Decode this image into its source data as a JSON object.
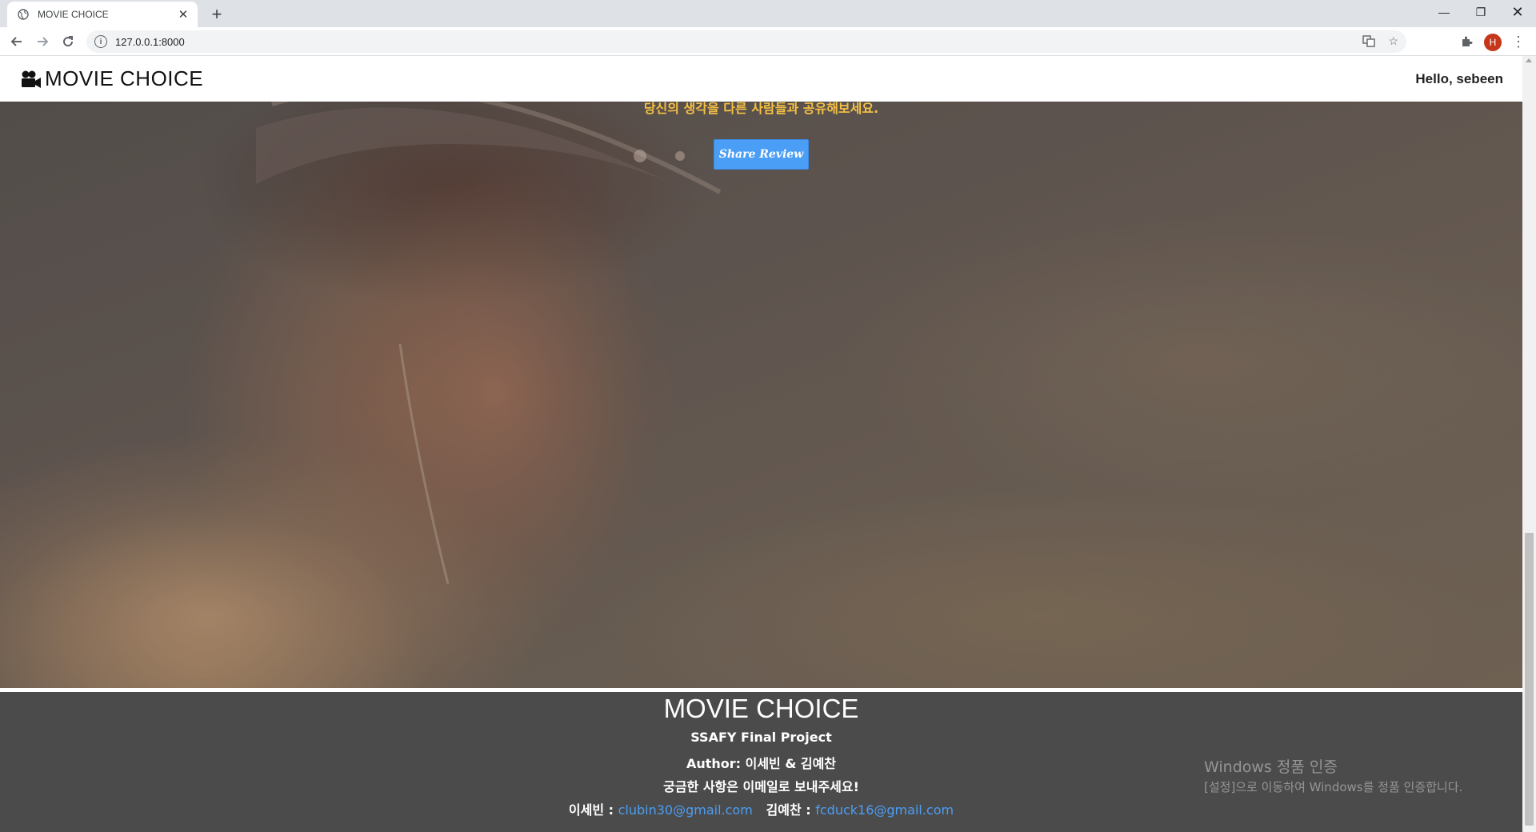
{
  "browser": {
    "tab_title": "MOVIE CHOICE",
    "url": "127.0.0.1:8000",
    "profile_initial": "H"
  },
  "navbar": {
    "brand": "MOVIE CHOICE",
    "greeting": "Hello, sebeen"
  },
  "hero": {
    "subtitle": "당신의 생각을 다른 사람들과 공유해보세요.",
    "share_button": "Share Review"
  },
  "footer": {
    "title": "MOVIE CHOICE",
    "project": "SSAFY Final Project",
    "authors": "Author: 이세빈 & 김예찬",
    "contact_note": "궁금한 사항은 이메일로 보내주세요!",
    "author1_label": "이세빈 :",
    "author1_email": "clubin30@gmail.com",
    "author2_label": "김예찬 :",
    "author2_email": "fcduck16@gmail.com"
  },
  "watermark": {
    "line1": "Windows 정품 인증",
    "line2": "[설정]으로 이동하여 Windows를 정품 인증합니다."
  },
  "colors": {
    "accent": "#4a9ef5",
    "subtitle": "#f5c044",
    "footer_bg": "#4c4b4b"
  }
}
